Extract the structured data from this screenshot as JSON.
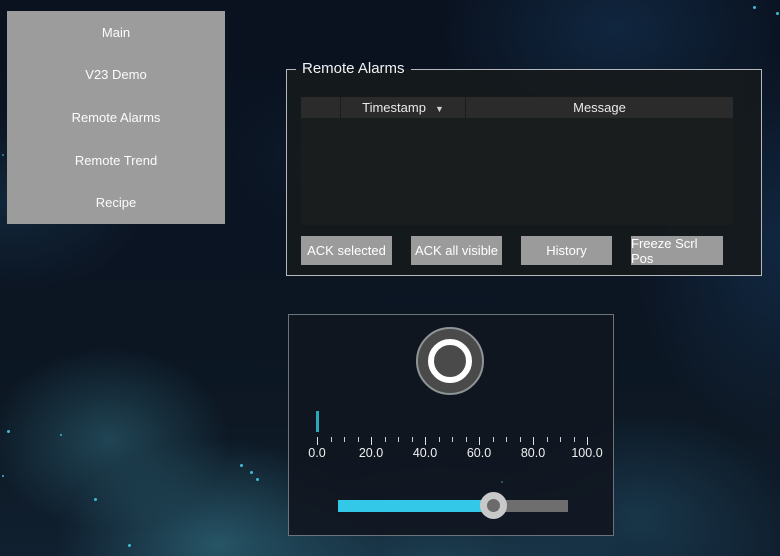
{
  "sidebar": {
    "items": [
      "Main",
      "V23 Demo",
      "Remote Alarms",
      "Remote Trend",
      "Recipe"
    ]
  },
  "alarms": {
    "title": "Remote Alarms",
    "table": {
      "columns": [
        "",
        "Timestamp",
        "Message"
      ],
      "sort_column": "Timestamp",
      "sort_icon": "▼",
      "rows": []
    },
    "buttons": [
      "ACK selected",
      "ACK all visible",
      "History",
      "Freeze Scrl Pos"
    ]
  },
  "control_panel": {
    "gauge": {
      "min": 0,
      "max": 100,
      "major_step": 20,
      "minor_step": 5,
      "value": 0,
      "tick_labels": [
        "0.0",
        "20.0",
        "40.0",
        "60.0",
        "80.0",
        "100.0"
      ]
    },
    "slider": {
      "min": 0,
      "max": 100,
      "value": 68
    }
  },
  "colors": {
    "accent_cyan": "#33c7e8",
    "gauge_bar_teal": "#2ba9ba",
    "sidebar_gray": "#9c9c9c",
    "button_gray": "#9b9b9b",
    "table_header": "#2b2b2b",
    "table_body": "#191d1d"
  }
}
